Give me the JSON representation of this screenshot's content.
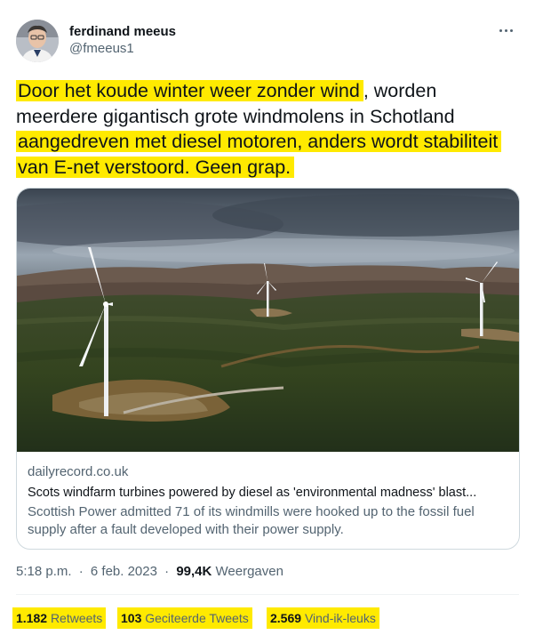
{
  "author": {
    "display_name": "ferdinand meeus",
    "handle": "@fmeeus1"
  },
  "tweet": {
    "text_1": "Door het koude winter weer zonder wind",
    "text_2": ", worden meerdere gigantisch grote windmolens in Schotland",
    "text_3": "aangedreven met diesel motoren, anders wordt stabiliteit van E-net verstoord. Geen grap."
  },
  "card": {
    "domain": "dailyrecord.co.uk",
    "title": "Scots windfarm turbines powered by diesel as 'environmental madness' blast...",
    "description": "Scottish Power admitted 71 of its windmills were hooked up to the fossil fuel supply after a fault developed with their power supply."
  },
  "meta": {
    "time": "5:18 p.m.",
    "separator": "·",
    "date": "6 feb. 2023",
    "views_count": "99,4K",
    "views_label": "Weergaven"
  },
  "stats": {
    "retweets_count": "1.182",
    "retweets_label": "Retweets",
    "quotes_count": "103",
    "quotes_label": "Geciteerde Tweets",
    "likes_count": "2.569",
    "likes_label": "Vind-ik-leuks"
  },
  "colors": {
    "highlight": "#ffea00",
    "text_primary": "#0f1419",
    "text_secondary": "#536471",
    "border": "#cfd9de"
  },
  "icons": {
    "more": "more-horizontal-icon"
  }
}
